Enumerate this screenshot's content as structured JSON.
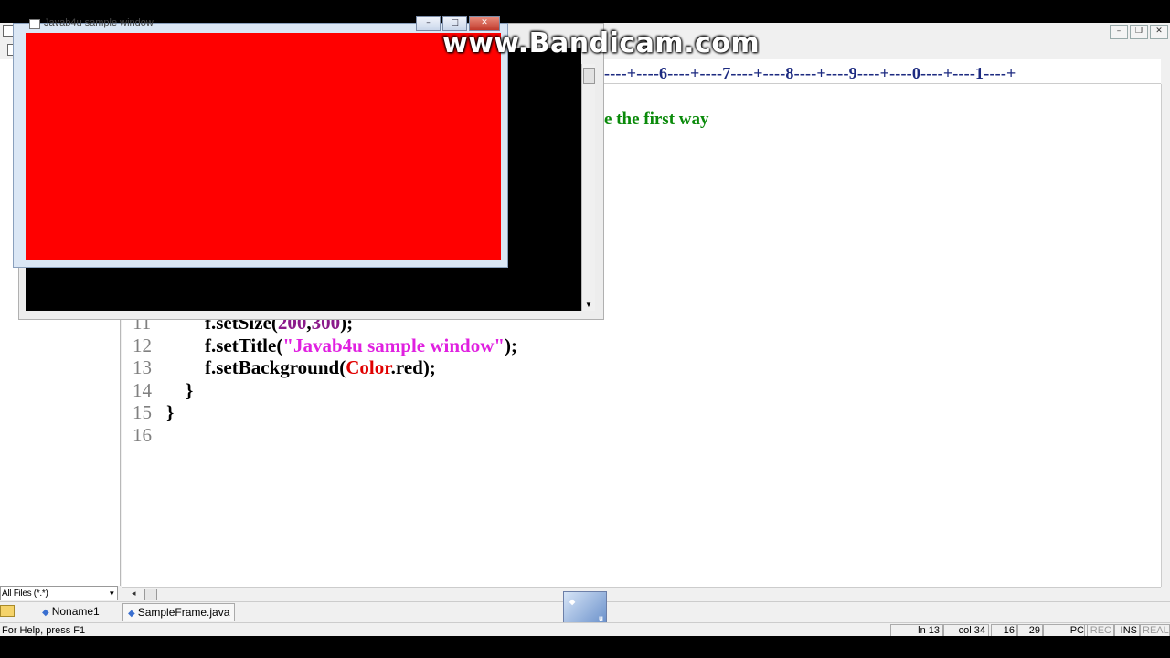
{
  "watermark": "www.Bandicam.com",
  "sample_window": {
    "title": "Javab4u sample window",
    "minimize": "–",
    "maximize": "□",
    "close": "✕"
  },
  "mdi_buttons": {
    "minimize": "–",
    "restore": "❐",
    "close": "✕"
  },
  "ruler": {
    "text": "----+----6----+----7----+----8----+----9----+----0----+----1----+"
  },
  "editor": {
    "comment_fragment": "e the first way",
    "lines": [
      {
        "num": "11",
        "segments": [
          {
            "t": "        f.setSize(",
            "c": "plain"
          },
          {
            "t": "200",
            "c": "num"
          },
          {
            "t": ",",
            "c": "plain"
          },
          {
            "t": "300",
            "c": "num"
          },
          {
            "t": ");",
            "c": "plain"
          }
        ]
      },
      {
        "num": "12",
        "segments": [
          {
            "t": "        f.setTitle(",
            "c": "plain"
          },
          {
            "t": "\"Javab4u sample window\"",
            "c": "str"
          },
          {
            "t": ");",
            "c": "plain"
          }
        ]
      },
      {
        "num": "13",
        "segments": [
          {
            "t": "        f.setBackground(",
            "c": "plain"
          },
          {
            "t": "Color",
            "c": "cls"
          },
          {
            "t": ".red);",
            "c": "plain"
          }
        ]
      },
      {
        "num": "14",
        "segments": [
          {
            "t": "    }",
            "c": "plain"
          }
        ]
      },
      {
        "num": "15",
        "segments": [
          {
            "t": "}",
            "c": "plain"
          }
        ]
      },
      {
        "num": "16",
        "segments": [
          {
            "t": "",
            "c": "plain"
          }
        ]
      }
    ]
  },
  "file_filter": {
    "value": "All Files (*.*)"
  },
  "tabs": [
    {
      "label": "Noname1"
    },
    {
      "label": "SampleFrame.java"
    }
  ],
  "statusbar": {
    "help": "For Help, press F1",
    "line": "ln 13",
    "col": "col 34",
    "a": "16",
    "b": "29",
    "mode": "PC",
    "rec": "REC",
    "ins": "INS",
    "read": "REAL"
  }
}
